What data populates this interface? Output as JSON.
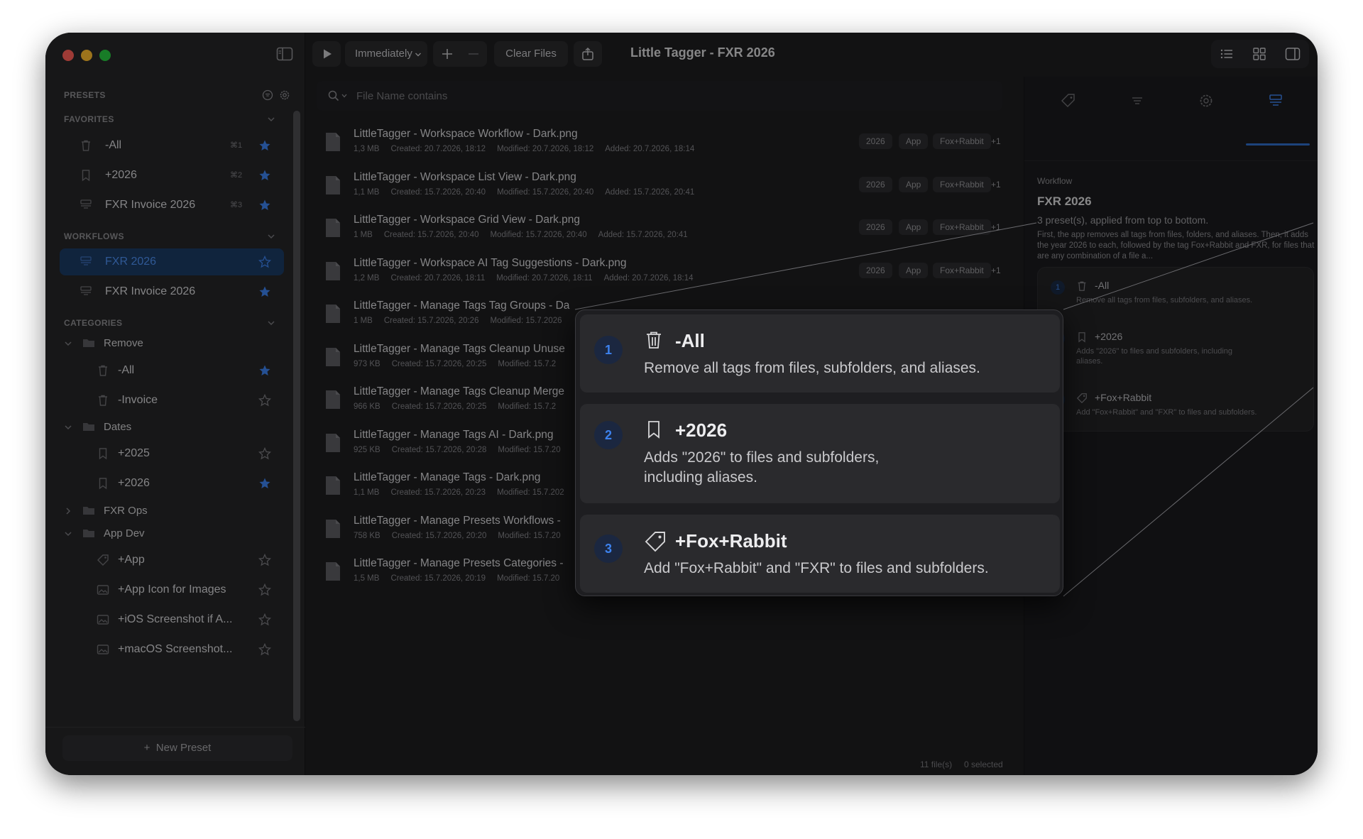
{
  "window": {
    "title": "Little Tagger - FXR 2026"
  },
  "toolbar": {
    "run_mode": "Immediately",
    "clear_files": "Clear Files"
  },
  "search": {
    "placeholder": "File Name contains"
  },
  "sidebar": {
    "presets_heading": "PRESETS",
    "favorites_heading": "FAVORITES",
    "favorites": [
      {
        "label": "-All",
        "shortcut": "⌘1",
        "icon": "trash-icon",
        "starred": true
      },
      {
        "label": "+2026",
        "shortcut": "⌘2",
        "icon": "bookmark-icon",
        "starred": true
      },
      {
        "label": "FXR Invoice 2026",
        "shortcut": "⌘3",
        "icon": "workflow-icon",
        "starred": true
      }
    ],
    "workflows_heading": "WORKFLOWS",
    "workflows": [
      {
        "label": "FXR 2026",
        "selected": true,
        "starred": false
      },
      {
        "label": "FXR Invoice 2026",
        "selected": false,
        "starred": true
      }
    ],
    "categories_heading": "CATEGORIES",
    "categories": {
      "remove": {
        "label": "Remove",
        "items": [
          {
            "label": "-All",
            "starred": true
          },
          {
            "label": "-Invoice",
            "starred": false
          }
        ]
      },
      "dates": {
        "label": "Dates",
        "items": [
          {
            "label": "+2025",
            "starred": false
          },
          {
            "label": "+2026",
            "starred": true
          }
        ]
      },
      "fxr_ops": {
        "label": "FXR Ops"
      },
      "app_dev": {
        "label": "App Dev",
        "items": [
          {
            "label": "+App",
            "icon": "tag-icon"
          },
          {
            "label": "+App Icon for Images",
            "icon": "image-icon"
          },
          {
            "label": "+iOS Screenshot if A...",
            "icon": "image-icon"
          },
          {
            "label": "+macOS Screenshot...",
            "icon": "image-icon"
          }
        ]
      }
    },
    "new_preset": "New Preset"
  },
  "files": [
    {
      "name": "LittleTagger - Workspace Workflow - Dark.png",
      "size": "1,3 MB",
      "created": "Created: 20.7.2026, 18:12",
      "modified": "Modified: 20.7.2026, 18:12",
      "added": "Added: 20.7.2026, 18:14",
      "tags": [
        "2026",
        "App",
        "Fox+Rabbit"
      ],
      "more": "+1"
    },
    {
      "name": "LittleTagger - Workspace List View - Dark.png",
      "size": "1,1 MB",
      "created": "Created: 15.7.2026, 20:40",
      "modified": "Modified: 15.7.2026, 20:40",
      "added": "Added: 15.7.2026, 20:41",
      "tags": [
        "2026",
        "App",
        "Fox+Rabbit"
      ],
      "more": "+1"
    },
    {
      "name": "LittleTagger - Workspace Grid View - Dark.png",
      "size": "1 MB",
      "created": "Created: 15.7.2026, 20:40",
      "modified": "Modified: 15.7.2026, 20:40",
      "added": "Added: 15.7.2026, 20:41",
      "tags": [
        "2026",
        "App",
        "Fox+Rabbit"
      ],
      "more": "+1"
    },
    {
      "name": "LittleTagger - Workspace AI Tag Suggestions - Dark.png",
      "size": "1,2 MB",
      "created": "Created: 20.7.2026, 18:11",
      "modified": "Modified: 20.7.2026, 18:11",
      "added": "Added: 20.7.2026, 18:14",
      "tags": [
        "2026",
        "App",
        "Fox+Rabbit"
      ],
      "more": "+1"
    },
    {
      "name": "LittleTagger - Manage Tags Tag Groups - Da",
      "size": "1 MB",
      "created": "Created: 15.7.2026, 20:26",
      "modified": "Modified: 15.7.2026",
      "added": "",
      "tags": [],
      "more": ""
    },
    {
      "name": "LittleTagger - Manage Tags Cleanup Unuse",
      "size": "973 KB",
      "created": "Created: 15.7.2026, 20:25",
      "modified": "Modified: 15.7.2",
      "added": "",
      "tags": [],
      "more": ""
    },
    {
      "name": "LittleTagger - Manage Tags Cleanup Merge",
      "size": "966 KB",
      "created": "Created: 15.7.2026, 20:25",
      "modified": "Modified: 15.7.2",
      "added": "",
      "tags": [],
      "more": ""
    },
    {
      "name": "LittleTagger - Manage Tags AI - Dark.png",
      "size": "925 KB",
      "created": "Created: 15.7.2026, 20:28",
      "modified": "Modified: 15.7.20",
      "added": "",
      "tags": [],
      "more": ""
    },
    {
      "name": "LittleTagger - Manage Tags - Dark.png",
      "size": "1,1 MB",
      "created": "Created: 15.7.2026, 20:23",
      "modified": "Modified: 15.7.202",
      "added": "",
      "tags": [],
      "more": ""
    },
    {
      "name": "LittleTagger - Manage Presets Workflows -",
      "size": "758 KB",
      "created": "Created: 15.7.2026, 20:20",
      "modified": "Modified: 15.7.20",
      "added": "",
      "tags": [],
      "more": ""
    },
    {
      "name": "LittleTagger - Manage Presets Categories -",
      "size": "1,5 MB",
      "created": "Created: 15.7.2026, 20:19",
      "modified": "Modified: 15.7.20",
      "added": "",
      "tags": [],
      "more": ""
    }
  ],
  "status": {
    "count": "11 file(s)",
    "selected": "0 selected"
  },
  "inspector": {
    "section_label": "Workflow",
    "title": "FXR 2026",
    "subtitle": "3 preset(s), applied from top to bottom.",
    "description": "First, the app removes all tags from files, folders, and aliases. Then, it adds the year 2026 to each, followed by the tag Fox+Rabbit and FXR, for files that are any combination of a file a...",
    "steps": [
      {
        "num": "1",
        "name": "-All",
        "desc": "Remove all tags from files, subfolders, and aliases."
      },
      {
        "num": "2",
        "name": "+2026",
        "desc": "Adds \"2026\" to files and subfolders, including aliases."
      },
      {
        "num": "3",
        "name": "+Fox+Rabbit",
        "desc": "Add \"Fox+Rabbit\" and \"FXR\" to files and subfolders."
      }
    ]
  },
  "popup": {
    "steps": [
      {
        "num": "1",
        "name": "-All",
        "desc": "Remove all tags from files, subfolders, and aliases."
      },
      {
        "num": "2",
        "name": "+2026",
        "desc": "Adds \"2026\" to files and subfolders,",
        "desc2": "including aliases."
      },
      {
        "num": "3",
        "name": "+Fox+Rabbit",
        "desc": "Add \"Fox+Rabbit\" and \"FXR\" to files and subfolders."
      }
    ]
  },
  "colors": {
    "accent": "#3d82ee",
    "selection": "#1b3a63",
    "window_bg": "#1d1d1f",
    "sidebar_bg": "#262628"
  }
}
